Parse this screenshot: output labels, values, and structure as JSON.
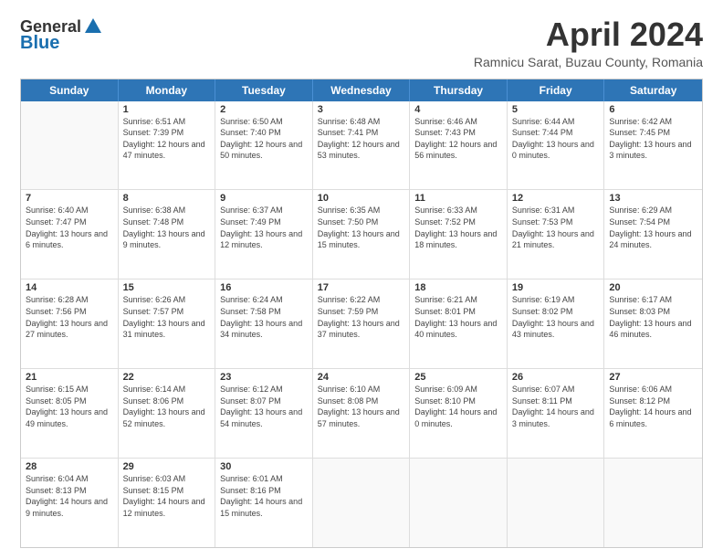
{
  "header": {
    "logo_general": "General",
    "logo_blue": "Blue",
    "title": "April 2024",
    "subtitle": "Ramnicu Sarat, Buzau County, Romania"
  },
  "weekdays": [
    "Sunday",
    "Monday",
    "Tuesday",
    "Wednesday",
    "Thursday",
    "Friday",
    "Saturday"
  ],
  "rows": [
    [
      {
        "day": "",
        "sunrise": "",
        "sunset": "",
        "daylight": "",
        "empty": true
      },
      {
        "day": "1",
        "sunrise": "Sunrise: 6:51 AM",
        "sunset": "Sunset: 7:39 PM",
        "daylight": "Daylight: 12 hours and 47 minutes."
      },
      {
        "day": "2",
        "sunrise": "Sunrise: 6:50 AM",
        "sunset": "Sunset: 7:40 PM",
        "daylight": "Daylight: 12 hours and 50 minutes."
      },
      {
        "day": "3",
        "sunrise": "Sunrise: 6:48 AM",
        "sunset": "Sunset: 7:41 PM",
        "daylight": "Daylight: 12 hours and 53 minutes."
      },
      {
        "day": "4",
        "sunrise": "Sunrise: 6:46 AM",
        "sunset": "Sunset: 7:43 PM",
        "daylight": "Daylight: 12 hours and 56 minutes."
      },
      {
        "day": "5",
        "sunrise": "Sunrise: 6:44 AM",
        "sunset": "Sunset: 7:44 PM",
        "daylight": "Daylight: 13 hours and 0 minutes."
      },
      {
        "day": "6",
        "sunrise": "Sunrise: 6:42 AM",
        "sunset": "Sunset: 7:45 PM",
        "daylight": "Daylight: 13 hours and 3 minutes."
      }
    ],
    [
      {
        "day": "7",
        "sunrise": "Sunrise: 6:40 AM",
        "sunset": "Sunset: 7:47 PM",
        "daylight": "Daylight: 13 hours and 6 minutes."
      },
      {
        "day": "8",
        "sunrise": "Sunrise: 6:38 AM",
        "sunset": "Sunset: 7:48 PM",
        "daylight": "Daylight: 13 hours and 9 minutes."
      },
      {
        "day": "9",
        "sunrise": "Sunrise: 6:37 AM",
        "sunset": "Sunset: 7:49 PM",
        "daylight": "Daylight: 13 hours and 12 minutes."
      },
      {
        "day": "10",
        "sunrise": "Sunrise: 6:35 AM",
        "sunset": "Sunset: 7:50 PM",
        "daylight": "Daylight: 13 hours and 15 minutes."
      },
      {
        "day": "11",
        "sunrise": "Sunrise: 6:33 AM",
        "sunset": "Sunset: 7:52 PM",
        "daylight": "Daylight: 13 hours and 18 minutes."
      },
      {
        "day": "12",
        "sunrise": "Sunrise: 6:31 AM",
        "sunset": "Sunset: 7:53 PM",
        "daylight": "Daylight: 13 hours and 21 minutes."
      },
      {
        "day": "13",
        "sunrise": "Sunrise: 6:29 AM",
        "sunset": "Sunset: 7:54 PM",
        "daylight": "Daylight: 13 hours and 24 minutes."
      }
    ],
    [
      {
        "day": "14",
        "sunrise": "Sunrise: 6:28 AM",
        "sunset": "Sunset: 7:56 PM",
        "daylight": "Daylight: 13 hours and 27 minutes."
      },
      {
        "day": "15",
        "sunrise": "Sunrise: 6:26 AM",
        "sunset": "Sunset: 7:57 PM",
        "daylight": "Daylight: 13 hours and 31 minutes."
      },
      {
        "day": "16",
        "sunrise": "Sunrise: 6:24 AM",
        "sunset": "Sunset: 7:58 PM",
        "daylight": "Daylight: 13 hours and 34 minutes."
      },
      {
        "day": "17",
        "sunrise": "Sunrise: 6:22 AM",
        "sunset": "Sunset: 7:59 PM",
        "daylight": "Daylight: 13 hours and 37 minutes."
      },
      {
        "day": "18",
        "sunrise": "Sunrise: 6:21 AM",
        "sunset": "Sunset: 8:01 PM",
        "daylight": "Daylight: 13 hours and 40 minutes."
      },
      {
        "day": "19",
        "sunrise": "Sunrise: 6:19 AM",
        "sunset": "Sunset: 8:02 PM",
        "daylight": "Daylight: 13 hours and 43 minutes."
      },
      {
        "day": "20",
        "sunrise": "Sunrise: 6:17 AM",
        "sunset": "Sunset: 8:03 PM",
        "daylight": "Daylight: 13 hours and 46 minutes."
      }
    ],
    [
      {
        "day": "21",
        "sunrise": "Sunrise: 6:15 AM",
        "sunset": "Sunset: 8:05 PM",
        "daylight": "Daylight: 13 hours and 49 minutes."
      },
      {
        "day": "22",
        "sunrise": "Sunrise: 6:14 AM",
        "sunset": "Sunset: 8:06 PM",
        "daylight": "Daylight: 13 hours and 52 minutes."
      },
      {
        "day": "23",
        "sunrise": "Sunrise: 6:12 AM",
        "sunset": "Sunset: 8:07 PM",
        "daylight": "Daylight: 13 hours and 54 minutes."
      },
      {
        "day": "24",
        "sunrise": "Sunrise: 6:10 AM",
        "sunset": "Sunset: 8:08 PM",
        "daylight": "Daylight: 13 hours and 57 minutes."
      },
      {
        "day": "25",
        "sunrise": "Sunrise: 6:09 AM",
        "sunset": "Sunset: 8:10 PM",
        "daylight": "Daylight: 14 hours and 0 minutes."
      },
      {
        "day": "26",
        "sunrise": "Sunrise: 6:07 AM",
        "sunset": "Sunset: 8:11 PM",
        "daylight": "Daylight: 14 hours and 3 minutes."
      },
      {
        "day": "27",
        "sunrise": "Sunrise: 6:06 AM",
        "sunset": "Sunset: 8:12 PM",
        "daylight": "Daylight: 14 hours and 6 minutes."
      }
    ],
    [
      {
        "day": "28",
        "sunrise": "Sunrise: 6:04 AM",
        "sunset": "Sunset: 8:13 PM",
        "daylight": "Daylight: 14 hours and 9 minutes."
      },
      {
        "day": "29",
        "sunrise": "Sunrise: 6:03 AM",
        "sunset": "Sunset: 8:15 PM",
        "daylight": "Daylight: 14 hours and 12 minutes."
      },
      {
        "day": "30",
        "sunrise": "Sunrise: 6:01 AM",
        "sunset": "Sunset: 8:16 PM",
        "daylight": "Daylight: 14 hours and 15 minutes."
      },
      {
        "day": "",
        "sunrise": "",
        "sunset": "",
        "daylight": "",
        "empty": true
      },
      {
        "day": "",
        "sunrise": "",
        "sunset": "",
        "daylight": "",
        "empty": true
      },
      {
        "day": "",
        "sunrise": "",
        "sunset": "",
        "daylight": "",
        "empty": true
      },
      {
        "day": "",
        "sunrise": "",
        "sunset": "",
        "daylight": "",
        "empty": true
      }
    ]
  ]
}
